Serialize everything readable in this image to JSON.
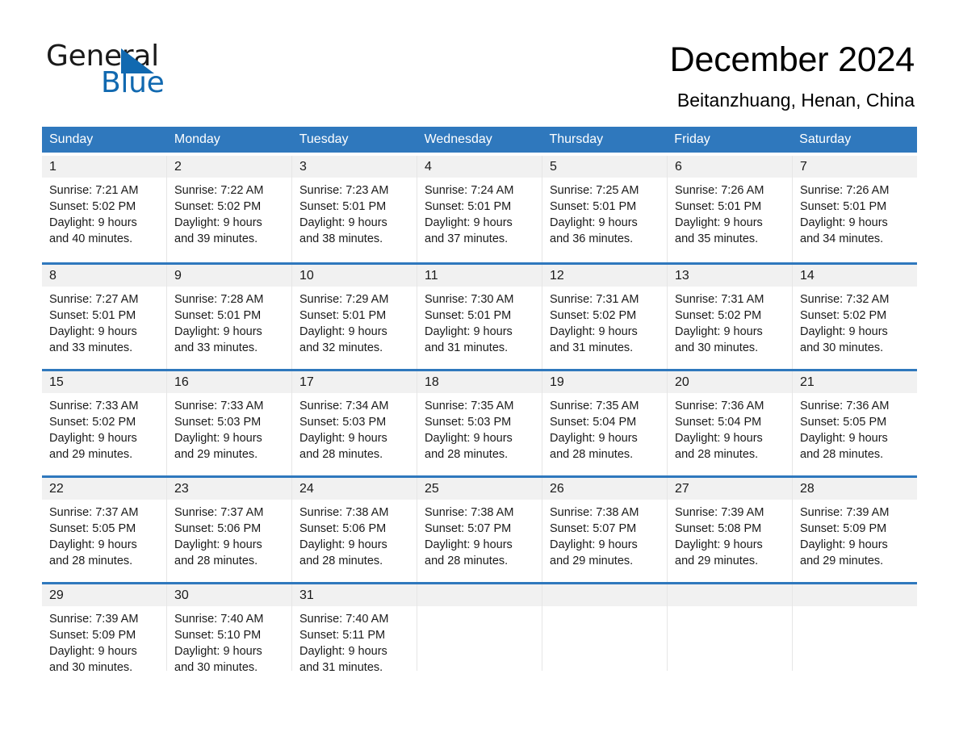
{
  "brand": {
    "name_part1": "General",
    "name_part2": "Blue",
    "triangle_icon": "brand-triangle-icon",
    "accent_color": "#1169b0"
  },
  "header": {
    "title": "December 2024",
    "location": "Beitanzhuang, Henan, China"
  },
  "theme": {
    "header_blue": "#2f78bd",
    "daynum_band": "#f1f1f1",
    "text": "#1a1a1a"
  },
  "calendar": {
    "weekday_headers": [
      "Sunday",
      "Monday",
      "Tuesday",
      "Wednesday",
      "Thursday",
      "Friday",
      "Saturday"
    ],
    "weeks": [
      [
        {
          "day": "1",
          "sunrise": "Sunrise: 7:21 AM",
          "sunset": "Sunset: 5:02 PM",
          "daylight_l1": "Daylight: 9 hours",
          "daylight_l2": "and 40 minutes."
        },
        {
          "day": "2",
          "sunrise": "Sunrise: 7:22 AM",
          "sunset": "Sunset: 5:02 PM",
          "daylight_l1": "Daylight: 9 hours",
          "daylight_l2": "and 39 minutes."
        },
        {
          "day": "3",
          "sunrise": "Sunrise: 7:23 AM",
          "sunset": "Sunset: 5:01 PM",
          "daylight_l1": "Daylight: 9 hours",
          "daylight_l2": "and 38 minutes."
        },
        {
          "day": "4",
          "sunrise": "Sunrise: 7:24 AM",
          "sunset": "Sunset: 5:01 PM",
          "daylight_l1": "Daylight: 9 hours",
          "daylight_l2": "and 37 minutes."
        },
        {
          "day": "5",
          "sunrise": "Sunrise: 7:25 AM",
          "sunset": "Sunset: 5:01 PM",
          "daylight_l1": "Daylight: 9 hours",
          "daylight_l2": "and 36 minutes."
        },
        {
          "day": "6",
          "sunrise": "Sunrise: 7:26 AM",
          "sunset": "Sunset: 5:01 PM",
          "daylight_l1": "Daylight: 9 hours",
          "daylight_l2": "and 35 minutes."
        },
        {
          "day": "7",
          "sunrise": "Sunrise: 7:26 AM",
          "sunset": "Sunset: 5:01 PM",
          "daylight_l1": "Daylight: 9 hours",
          "daylight_l2": "and 34 minutes."
        }
      ],
      [
        {
          "day": "8",
          "sunrise": "Sunrise: 7:27 AM",
          "sunset": "Sunset: 5:01 PM",
          "daylight_l1": "Daylight: 9 hours",
          "daylight_l2": "and 33 minutes."
        },
        {
          "day": "9",
          "sunrise": "Sunrise: 7:28 AM",
          "sunset": "Sunset: 5:01 PM",
          "daylight_l1": "Daylight: 9 hours",
          "daylight_l2": "and 33 minutes."
        },
        {
          "day": "10",
          "sunrise": "Sunrise: 7:29 AM",
          "sunset": "Sunset: 5:01 PM",
          "daylight_l1": "Daylight: 9 hours",
          "daylight_l2": "and 32 minutes."
        },
        {
          "day": "11",
          "sunrise": "Sunrise: 7:30 AM",
          "sunset": "Sunset: 5:01 PM",
          "daylight_l1": "Daylight: 9 hours",
          "daylight_l2": "and 31 minutes."
        },
        {
          "day": "12",
          "sunrise": "Sunrise: 7:31 AM",
          "sunset": "Sunset: 5:02 PM",
          "daylight_l1": "Daylight: 9 hours",
          "daylight_l2": "and 31 minutes."
        },
        {
          "day": "13",
          "sunrise": "Sunrise: 7:31 AM",
          "sunset": "Sunset: 5:02 PM",
          "daylight_l1": "Daylight: 9 hours",
          "daylight_l2": "and 30 minutes."
        },
        {
          "day": "14",
          "sunrise": "Sunrise: 7:32 AM",
          "sunset": "Sunset: 5:02 PM",
          "daylight_l1": "Daylight: 9 hours",
          "daylight_l2": "and 30 minutes."
        }
      ],
      [
        {
          "day": "15",
          "sunrise": "Sunrise: 7:33 AM",
          "sunset": "Sunset: 5:02 PM",
          "daylight_l1": "Daylight: 9 hours",
          "daylight_l2": "and 29 minutes."
        },
        {
          "day": "16",
          "sunrise": "Sunrise: 7:33 AM",
          "sunset": "Sunset: 5:03 PM",
          "daylight_l1": "Daylight: 9 hours",
          "daylight_l2": "and 29 minutes."
        },
        {
          "day": "17",
          "sunrise": "Sunrise: 7:34 AM",
          "sunset": "Sunset: 5:03 PM",
          "daylight_l1": "Daylight: 9 hours",
          "daylight_l2": "and 28 minutes."
        },
        {
          "day": "18",
          "sunrise": "Sunrise: 7:35 AM",
          "sunset": "Sunset: 5:03 PM",
          "daylight_l1": "Daylight: 9 hours",
          "daylight_l2": "and 28 minutes."
        },
        {
          "day": "19",
          "sunrise": "Sunrise: 7:35 AM",
          "sunset": "Sunset: 5:04 PM",
          "daylight_l1": "Daylight: 9 hours",
          "daylight_l2": "and 28 minutes."
        },
        {
          "day": "20",
          "sunrise": "Sunrise: 7:36 AM",
          "sunset": "Sunset: 5:04 PM",
          "daylight_l1": "Daylight: 9 hours",
          "daylight_l2": "and 28 minutes."
        },
        {
          "day": "21",
          "sunrise": "Sunrise: 7:36 AM",
          "sunset": "Sunset: 5:05 PM",
          "daylight_l1": "Daylight: 9 hours",
          "daylight_l2": "and 28 minutes."
        }
      ],
      [
        {
          "day": "22",
          "sunrise": "Sunrise: 7:37 AM",
          "sunset": "Sunset: 5:05 PM",
          "daylight_l1": "Daylight: 9 hours",
          "daylight_l2": "and 28 minutes."
        },
        {
          "day": "23",
          "sunrise": "Sunrise: 7:37 AM",
          "sunset": "Sunset: 5:06 PM",
          "daylight_l1": "Daylight: 9 hours",
          "daylight_l2": "and 28 minutes."
        },
        {
          "day": "24",
          "sunrise": "Sunrise: 7:38 AM",
          "sunset": "Sunset: 5:06 PM",
          "daylight_l1": "Daylight: 9 hours",
          "daylight_l2": "and 28 minutes."
        },
        {
          "day": "25",
          "sunrise": "Sunrise: 7:38 AM",
          "sunset": "Sunset: 5:07 PM",
          "daylight_l1": "Daylight: 9 hours",
          "daylight_l2": "and 28 minutes."
        },
        {
          "day": "26",
          "sunrise": "Sunrise: 7:38 AM",
          "sunset": "Sunset: 5:07 PM",
          "daylight_l1": "Daylight: 9 hours",
          "daylight_l2": "and 29 minutes."
        },
        {
          "day": "27",
          "sunrise": "Sunrise: 7:39 AM",
          "sunset": "Sunset: 5:08 PM",
          "daylight_l1": "Daylight: 9 hours",
          "daylight_l2": "and 29 minutes."
        },
        {
          "day": "28",
          "sunrise": "Sunrise: 7:39 AM",
          "sunset": "Sunset: 5:09 PM",
          "daylight_l1": "Daylight: 9 hours",
          "daylight_l2": "and 29 minutes."
        }
      ],
      [
        {
          "day": "29",
          "sunrise": "Sunrise: 7:39 AM",
          "sunset": "Sunset: 5:09 PM",
          "daylight_l1": "Daylight: 9 hours",
          "daylight_l2": "and 30 minutes."
        },
        {
          "day": "30",
          "sunrise": "Sunrise: 7:40 AM",
          "sunset": "Sunset: 5:10 PM",
          "daylight_l1": "Daylight: 9 hours",
          "daylight_l2": "and 30 minutes."
        },
        {
          "day": "31",
          "sunrise": "Sunrise: 7:40 AM",
          "sunset": "Sunset: 5:11 PM",
          "daylight_l1": "Daylight: 9 hours",
          "daylight_l2": "and 31 minutes."
        },
        {
          "day": "",
          "sunrise": "",
          "sunset": "",
          "daylight_l1": "",
          "daylight_l2": ""
        },
        {
          "day": "",
          "sunrise": "",
          "sunset": "",
          "daylight_l1": "",
          "daylight_l2": ""
        },
        {
          "day": "",
          "sunrise": "",
          "sunset": "",
          "daylight_l1": "",
          "daylight_l2": ""
        },
        {
          "day": "",
          "sunrise": "",
          "sunset": "",
          "daylight_l1": "",
          "daylight_l2": ""
        }
      ]
    ]
  }
}
